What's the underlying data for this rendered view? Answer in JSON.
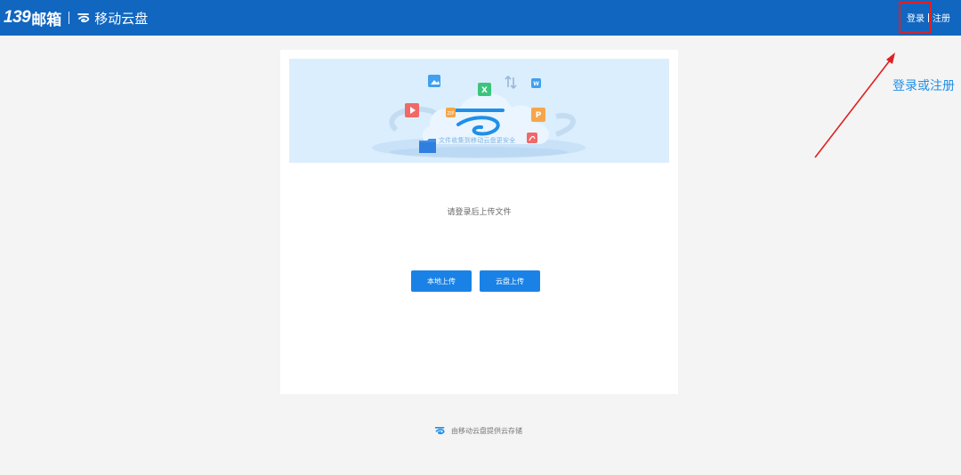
{
  "header": {
    "brand_number": "139",
    "brand_mail": "邮箱",
    "brand_product": "移动云盘",
    "login_label": "登录",
    "register_label": "注册"
  },
  "annotation": {
    "text": "登录或注册",
    "highlight_color": "#e02020",
    "text_color": "#1f8fe8"
  },
  "banner": {
    "caption": "文件收集到移动云盘更安全",
    "file_icons": [
      "image-icon",
      "excel-icon",
      "transfer-icon",
      "word-icon",
      "video-icon",
      "zip-icon",
      "ppt-icon",
      "pdf-icon",
      "folder-icon"
    ]
  },
  "main": {
    "prompt": "请登录后上传文件",
    "local_upload_label": "本地上传",
    "cloud_upload_label": "云盘上传"
  },
  "footer": {
    "text": "由移动云盘提供云存储"
  },
  "colors": {
    "header_bg": "#1166c0",
    "button_bg": "#1a82e6",
    "page_bg": "#f4f4f4"
  }
}
